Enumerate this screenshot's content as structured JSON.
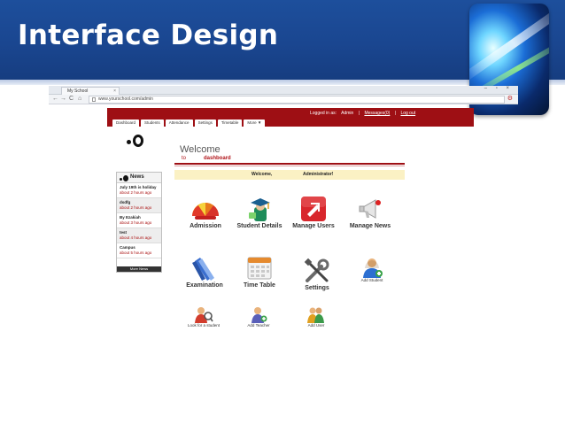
{
  "slide": {
    "title": "Interface Design"
  },
  "browser": {
    "tab_title": "My School",
    "tab_close": "×",
    "window_buttons": "– ▫ ×",
    "url": "www.yourschool.com/admin",
    "back": "←",
    "forward": "→",
    "reload": "C",
    "home": "⌂",
    "wrench": "⚙"
  },
  "header": {
    "logged_in_as": "Logged in as:",
    "user": "Admin",
    "separator": "|",
    "messages": "Messages(0)",
    "logout": "Log out",
    "menu": [
      "Dashboard",
      "Students",
      "Attendance",
      "Settings",
      "Timetable",
      "More ▼"
    ]
  },
  "news": {
    "title": "News",
    "items": [
      {
        "title": "July 19th is holiday",
        "time": "about 2 hours ago"
      },
      {
        "title": "dsdfg",
        "time": "about 2 hours ago"
      },
      {
        "title": "By Ezakiah",
        "time": "about 3 hours ago"
      },
      {
        "title": "test",
        "time": "about 4 hours ago"
      },
      {
        "title": "Campus",
        "time": "about 5 hours ago"
      }
    ],
    "more": "More News"
  },
  "welcome": {
    "title": "Welcome",
    "to": "to",
    "dashboard": "dashboard",
    "greeting": "Welcome,",
    "name": "Administrator!"
  },
  "tiles": {
    "admission": "Admission",
    "student_details": "Student Details",
    "manage_users": "Manage Users",
    "manage_news": "Manage News",
    "examination": "Examination",
    "time_table": "Time Table",
    "settings": "Settings",
    "add_student": "Add Student",
    "look_for_student": "Look for a student",
    "add_teacher": "Add Teacher",
    "add_user": "Add User"
  },
  "colors": {
    "banner_blue": "#1a4690",
    "app_red": "#9e0f14",
    "notice_yellow": "#fbf1c4"
  }
}
